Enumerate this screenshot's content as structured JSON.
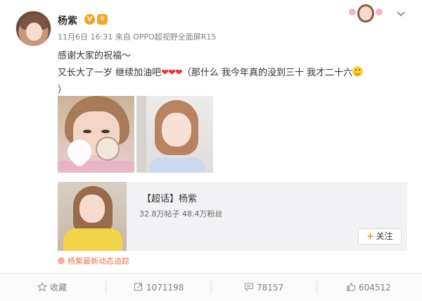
{
  "post": {
    "username": "杨紫",
    "v_badge": "V",
    "vip_badge": "♛",
    "meta": "11月6日 16:31 来自 OPPO超视野全面屏R15",
    "text_line1": "感谢大家的祝福～",
    "text_line2_a": "又长大了一岁 继续加油吧",
    "text_line2_hearts": "❤❤❤",
    "text_line2_b": "（那什么 我今年真的没到三十 我才二十六",
    "text_line3": "）"
  },
  "topic": {
    "title": "【超话】杨紫",
    "stats": "32.8万帖子 48.4万粉丝",
    "follow_plus": "+",
    "follow_label": "关注"
  },
  "track_link": "杨紫最新动态追踪",
  "actions": {
    "favorite_label": "收藏",
    "repost_count": "1071198",
    "comment_count": "78157",
    "like_count": "604512"
  },
  "icons": {
    "chevron": "chevron-down-icon",
    "favorite": "star-icon",
    "repost": "repost-icon",
    "comment": "comment-icon",
    "like": "thumbs-up-icon"
  }
}
